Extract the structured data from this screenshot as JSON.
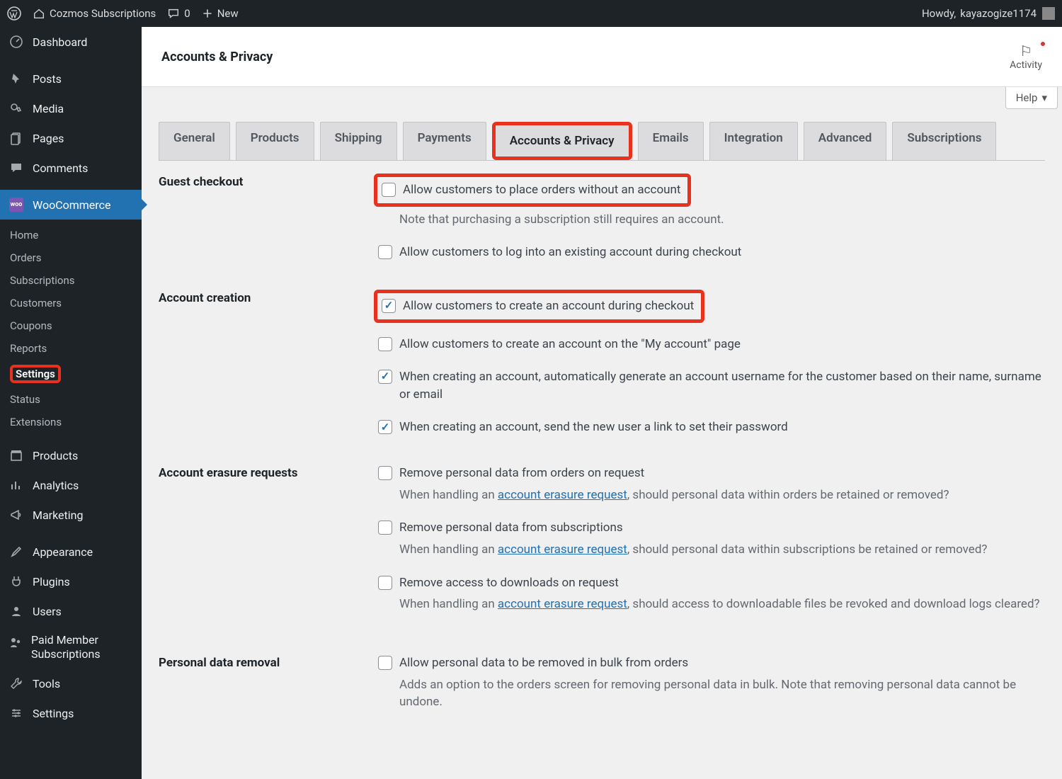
{
  "adminbar": {
    "site_name": "Cozmos Subscriptions",
    "comments_count": "0",
    "new_label": "New",
    "howdy_prefix": "Howdy, ",
    "username": "kayazogize1174"
  },
  "sidebar": {
    "items": [
      {
        "label": "Dashboard"
      },
      {
        "label": "Posts"
      },
      {
        "label": "Media"
      },
      {
        "label": "Pages"
      },
      {
        "label": "Comments"
      },
      {
        "label": "WooCommerce"
      },
      {
        "label": "Products"
      },
      {
        "label": "Analytics"
      },
      {
        "label": "Marketing"
      },
      {
        "label": "Appearance"
      },
      {
        "label": "Plugins"
      },
      {
        "label": "Users"
      },
      {
        "label": "Paid Member Subscriptions"
      },
      {
        "label": "Tools"
      },
      {
        "label": "Settings"
      }
    ],
    "woo_sub": {
      "items": [
        {
          "label": "Home"
        },
        {
          "label": "Orders"
        },
        {
          "label": "Subscriptions"
        },
        {
          "label": "Customers"
        },
        {
          "label": "Coupons"
        },
        {
          "label": "Reports"
        },
        {
          "label": "Settings"
        },
        {
          "label": "Status"
        },
        {
          "label": "Extensions"
        }
      ]
    }
  },
  "page": {
    "title": "Accounts & Privacy",
    "activity_label": "Activity",
    "help_label": "Help"
  },
  "tabs": [
    {
      "label": "General"
    },
    {
      "label": "Products"
    },
    {
      "label": "Shipping"
    },
    {
      "label": "Payments"
    },
    {
      "label": "Accounts & Privacy"
    },
    {
      "label": "Emails"
    },
    {
      "label": "Integration"
    },
    {
      "label": "Advanced"
    },
    {
      "label": "Subscriptions"
    }
  ],
  "sections": {
    "guest_checkout": {
      "heading": "Guest checkout",
      "opt1": "Allow customers to place orders without an account",
      "note1": "Note that purchasing a subscription still requires an account.",
      "opt2": "Allow customers to log into an existing account during checkout"
    },
    "account_creation": {
      "heading": "Account creation",
      "opt1": "Allow customers to create an account during checkout",
      "opt2": "Allow customers to create an account on the \"My account\" page",
      "opt3": "When creating an account, automatically generate an account username for the customer based on their name, surname or email",
      "opt4": "When creating an account, send the new user a link to set their password"
    },
    "erasure": {
      "heading": "Account erasure requests",
      "opt1": "Remove personal data from orders on request",
      "note1_a": "When handling an ",
      "note1_link": "account erasure request",
      "note1_b": ", should personal data within orders be retained or removed?",
      "opt2": "Remove personal data from subscriptions",
      "note2_a": "When handling an ",
      "note2_link": "account erasure request",
      "note2_b": ", should personal data within subscriptions be retained or removed?",
      "opt3": "Remove access to downloads on request",
      "note3_a": "When handling an ",
      "note3_link": "account erasure request",
      "note3_b": ", should access to downloadable files be revoked and download logs cleared?"
    },
    "personal_removal": {
      "heading": "Personal data removal",
      "opt1": "Allow personal data to be removed in bulk from orders",
      "note1": "Adds an option to the orders screen for removing personal data in bulk. Note that removing personal data cannot be undone."
    }
  }
}
